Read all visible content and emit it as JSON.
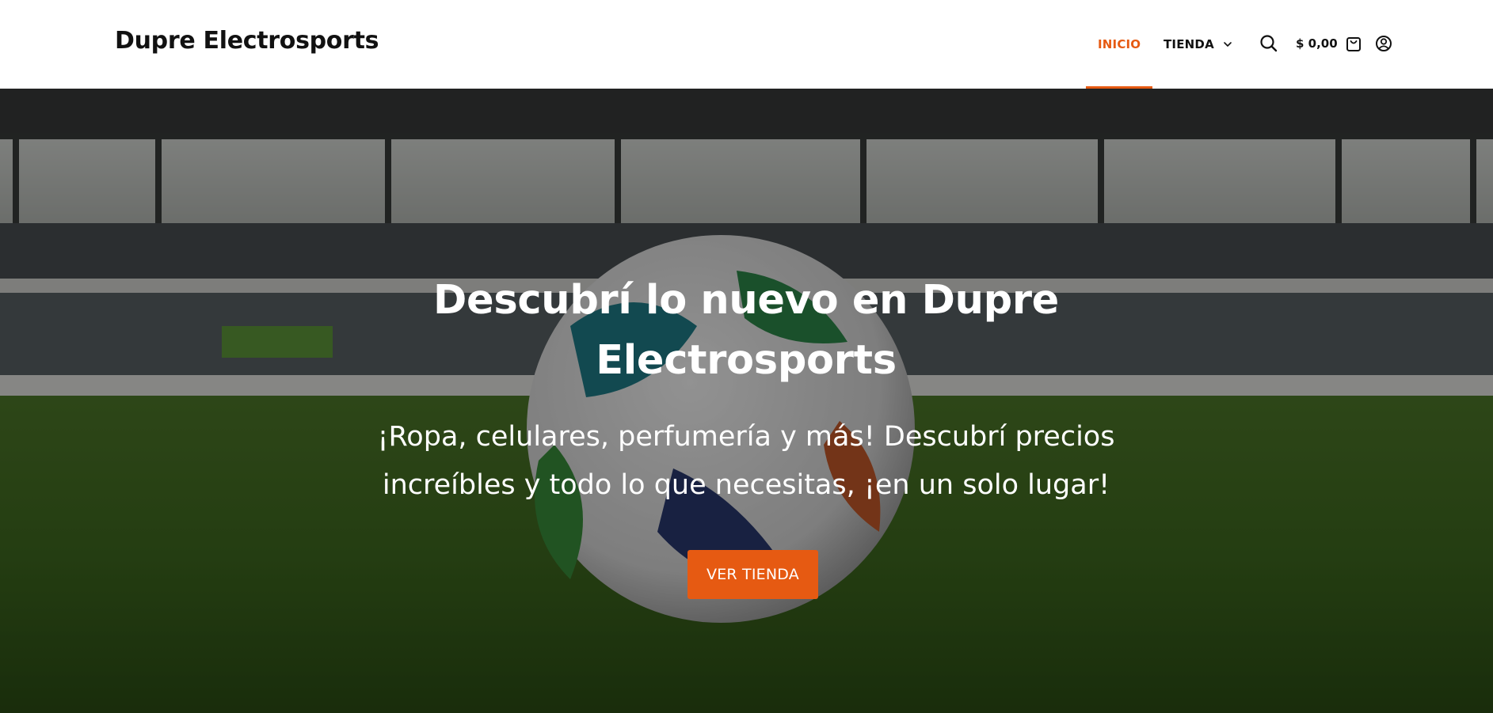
{
  "header": {
    "brand": "Dupre Electrosports",
    "nav": [
      {
        "label": "INICIO",
        "active": true
      },
      {
        "label": "TIENDA",
        "active": false,
        "has_dropdown": true
      }
    ],
    "cart_total": "$ 0,00",
    "icons": [
      "search-icon",
      "cart-icon",
      "account-icon",
      "chevron-down-icon"
    ],
    "accent_color": "#e65a12"
  },
  "hero": {
    "title": "Descubrí lo nuevo en Dupre Electrosports",
    "subtitle": "¡Ropa, celulares, perfumería y más! Descubrí precios increíbles y todo lo que necesitas, ¡en un solo lugar!",
    "cta_label": "VER TIENDA",
    "background": "stadium-football-photo"
  }
}
